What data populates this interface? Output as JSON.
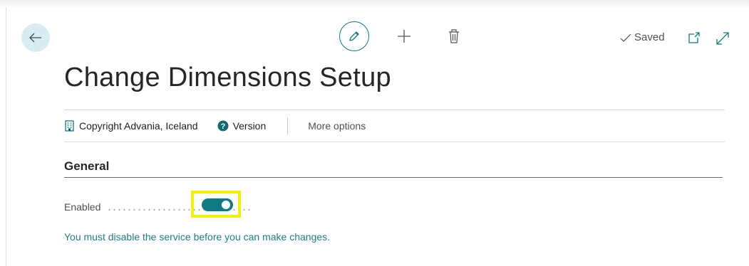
{
  "header": {
    "title": "Change Dimensions Setup",
    "status": "Saved"
  },
  "toolbar": {
    "back_icon": "arrow-left-icon",
    "edit_icon": "pencil-icon",
    "new_icon": "plus-icon",
    "delete_icon": "trash-icon",
    "saved_icon": "checkmark-icon",
    "open_new_window_icon": "open-in-new-window-icon",
    "expand_icon": "expand-icon"
  },
  "actions": {
    "copyright_label": "Copyright Advania, Iceland",
    "version_label": "Version",
    "more_label": "More options"
  },
  "section": {
    "title": "General"
  },
  "fields": {
    "enabled_label": "Enabled",
    "enabled_value": true
  },
  "notice": "You must disable the service before you can make changes.",
  "colors": {
    "accent": "#0f7a83",
    "back_button_bg": "#d7edf2",
    "highlight": "#f2f200",
    "notice_text": "#1a7f86"
  }
}
